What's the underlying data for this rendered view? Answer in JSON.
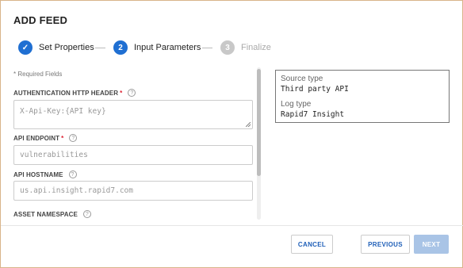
{
  "dialog": {
    "title": "ADD FEED"
  },
  "stepper": {
    "steps": [
      {
        "number": "✓",
        "label": "Set Properties",
        "state": "done"
      },
      {
        "number": "2",
        "label": "Input Parameters",
        "state": "active"
      },
      {
        "number": "3",
        "label": "Finalize",
        "state": "pending"
      }
    ]
  },
  "form": {
    "required_note": "* Required Fields",
    "fields": [
      {
        "label": "AUTHENTICATION HTTP HEADER",
        "required": "*",
        "placeholder": "X-Api-Key:{API key}"
      },
      {
        "label": "API ENDPOINT",
        "required": "*",
        "placeholder": "vulnerabilities"
      },
      {
        "label": "API HOSTNAME",
        "required": "",
        "placeholder": "us.api.insight.rapid7.com"
      },
      {
        "label": "ASSET NAMESPACE",
        "required": ""
      }
    ],
    "help_glyph": "?"
  },
  "info": {
    "source_type_label": "Source type",
    "source_type_value": "Third party API",
    "log_type_label": "Log type",
    "log_type_value": "Rapid7 Insight"
  },
  "footer": {
    "cancel_label": "CANCEL",
    "previous_label": "PREVIOUS",
    "next_label": "NEXT"
  },
  "colors": {
    "primary": "#1f6fd2",
    "pending": "#c8c8c8",
    "required": "#dd2233",
    "disabled": "#a9c4e6"
  },
  "icons": {
    "done_step": "check-icon",
    "help": "question-circle-icon",
    "resize": "resize-handle-icon"
  }
}
